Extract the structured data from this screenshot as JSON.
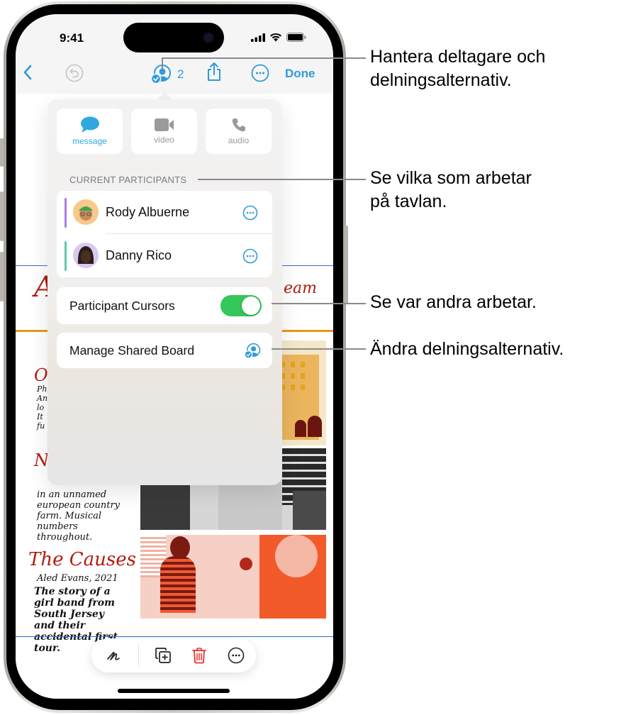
{
  "status_bar": {
    "time": "9:41"
  },
  "nav": {
    "back_icon": "chevron-left-icon",
    "undo_icon": "undo-icon",
    "participants_icon": "person-circle-checkmark-icon",
    "participants_count": "2",
    "share_icon": "share-icon",
    "more_icon": "ellipsis-circle-icon",
    "done_label": "Done"
  },
  "popover": {
    "communication": [
      {
        "label": "message",
        "icon": "message-bubble-icon",
        "active": true
      },
      {
        "label": "video",
        "icon": "video-camera-icon",
        "active": false
      },
      {
        "label": "audio",
        "icon": "phone-icon",
        "active": false
      }
    ],
    "section_header": "CURRENT PARTICIPANTS",
    "participants": [
      {
        "name": "Rody Albuerne",
        "color": "#a97ce6",
        "avatar_bg": "#f7c98a"
      },
      {
        "name": "Danny Rico",
        "color": "#5ec9a6",
        "avatar_bg": "#d9c8f0"
      }
    ],
    "cursors_label": "Participant Cursors",
    "cursors_enabled": true,
    "manage_label": "Manage Shared Board"
  },
  "board": {
    "handwriting": {
      "title_partial_left": "A",
      "title_partial_right": "eam",
      "entry1_initial": "O.",
      "entry2_initial": "N.",
      "entry2_text": "in an unnamed european country farm. Musical numbers throughout.",
      "entry3_title": "The Causes",
      "entry3_author": "Aled Evans, 2021",
      "entry3_text": "The story of a girl band from South Jersey and their accidental first tour."
    }
  },
  "bottom_toolbar": {
    "items": [
      {
        "icon": "scribble-pen-icon"
      },
      {
        "icon": "duplicate-plus-icon"
      },
      {
        "icon": "trash-icon"
      },
      {
        "icon": "ellipsis-circle-icon"
      }
    ]
  },
  "callouts": [
    {
      "text": "Hantera deltagare och\ndelningsalternativ."
    },
    {
      "text": "Se vilka som arbetar\npå tavlan."
    },
    {
      "text": "Se var andra arbetar."
    },
    {
      "text": "Ändra delningsalternativ."
    }
  ],
  "colors": {
    "accent": "#2f9ad9",
    "toggle_on": "#34c759",
    "trash": "#e5302a",
    "orange_rule": "#e49a17",
    "handwriting_red": "#b11b10"
  }
}
